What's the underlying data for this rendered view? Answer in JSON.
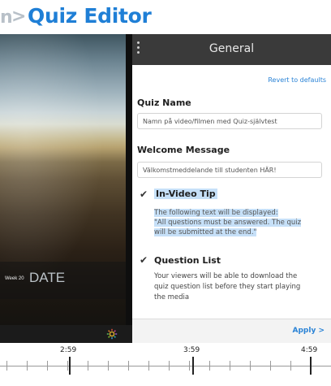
{
  "header": {
    "prev_crumb": "n",
    "separator": ">",
    "title": "Quiz Editor"
  },
  "video": {
    "week_label": "Week 20",
    "date_label": "DATE"
  },
  "panel": {
    "title": "General",
    "revert_label": "Revert to defaults",
    "quiz_name": {
      "label": "Quiz Name",
      "value": "Namn på video/filmen med Quiz-självtest"
    },
    "welcome": {
      "label": "Welcome Message",
      "value": "Välkomstmeddelande till studenten HÄR!"
    },
    "in_video_tip": {
      "checked": true,
      "label": "In-Video Tip",
      "text_line1": "The following text will be displayed:",
      "text_line2": "\"All questions must be answered. The quiz",
      "text_line3": "will be submitted at the end.\""
    },
    "question_list": {
      "checked": true,
      "label": "Question List",
      "text_line1": "Your viewers will be able to download the",
      "text_line2": "quiz question list before they start playing",
      "text_line3": "the media"
    },
    "apply_label": "Apply >"
  },
  "timeline": {
    "labels": [
      "2:59",
      "3:59",
      "4:59"
    ]
  },
  "colors": {
    "accent": "#1f7fd6",
    "highlight": "#c6e0f8",
    "panel_header": "#3a3a3a"
  },
  "icons": {
    "menu": "kebab-menu-icon",
    "check": "checkmark-icon",
    "settings": "gear-icon"
  }
}
